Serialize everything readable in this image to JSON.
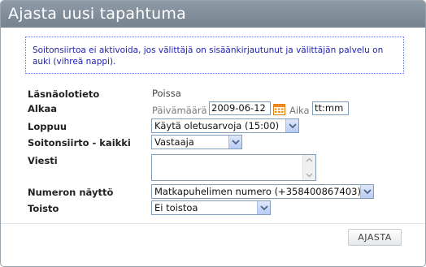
{
  "dialog": {
    "title": "Ajasta uusi tapahtuma",
    "info_text": "Soitonsiirtoa ei aktivoida, jos välittäjä on sisäänkirjautunut ja välittäjän palvelu on auki (vihreä nappi)."
  },
  "form": {
    "presence": {
      "label": "Läsnäolotieto",
      "value": "Poissa"
    },
    "start": {
      "label": "Alkaa",
      "date_label": "Päivämäärä",
      "date_value": "2009-06-12",
      "time_label": "Aika",
      "time_value": "tt:mm"
    },
    "end": {
      "label": "Loppuu",
      "selected": "Käytä oletusarvoja (15:00)"
    },
    "forwarding": {
      "label": "Soitonsiirto - kaikki",
      "selected": "Vastaaja"
    },
    "message": {
      "label": "Viesti",
      "value": ""
    },
    "number_display": {
      "label": "Numeron näyttö",
      "selected": "Matkapuhelimen numero (+358400867403)"
    },
    "repeat": {
      "label": "Toisto",
      "selected": "Ei toistoa"
    }
  },
  "actions": {
    "schedule_label": "AJASTA"
  },
  "colors": {
    "titlebar": "#7f8b97",
    "info_text": "#1c1fb0",
    "calendar_icon": "#f08a1c"
  }
}
